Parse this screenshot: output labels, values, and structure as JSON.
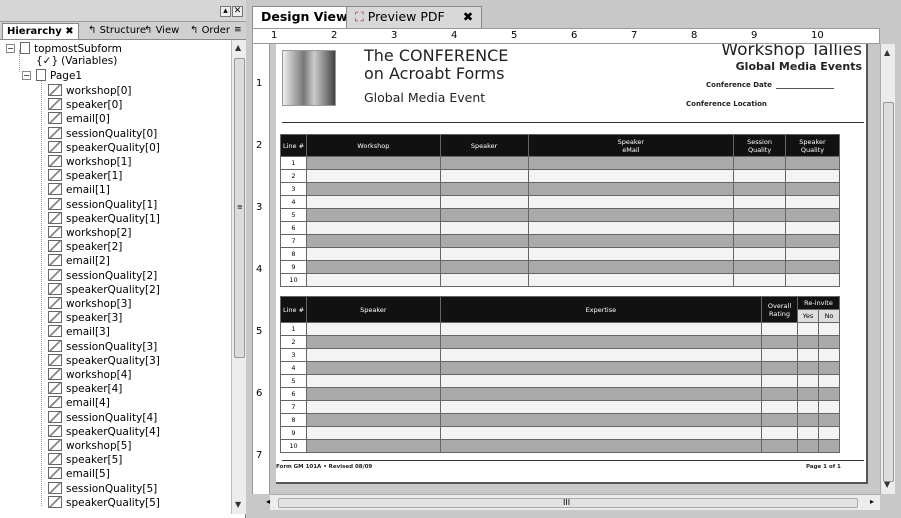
{
  "left_panel": {
    "tabs": [
      "Hierarchy",
      "Structure",
      "View",
      "Order"
    ],
    "tree": {
      "root": "topmostSubform",
      "variables": "(Variables)",
      "page": "Page1",
      "fields": [
        "workshop[0]",
        "speaker[0]",
        "email[0]",
        "sessionQuality[0]",
        "speakerQuality[0]",
        "workshop[1]",
        "speaker[1]",
        "email[1]",
        "sessionQuality[1]",
        "speakerQuality[1]",
        "workshop[2]",
        "speaker[2]",
        "email[2]",
        "sessionQuality[2]",
        "speakerQuality[2]",
        "workshop[3]",
        "speaker[3]",
        "email[3]",
        "sessionQuality[3]",
        "speakerQuality[3]",
        "workshop[4]",
        "speaker[4]",
        "email[4]",
        "sessionQuality[4]",
        "speakerQuality[4]",
        "workshop[5]",
        "speaker[5]",
        "email[5]",
        "sessionQuality[5]",
        "speakerQuality[5]"
      ]
    }
  },
  "doc_tabs": {
    "design": "Design View",
    "preview": "Preview PDF"
  },
  "ruler": {
    "top": [
      "1",
      "2",
      "3",
      "4",
      "5",
      "6",
      "7",
      "8",
      "9",
      "10"
    ],
    "left": [
      "1",
      "2",
      "3",
      "4",
      "5",
      "6",
      "7"
    ]
  },
  "form": {
    "title_line1": "The CONFERENCE",
    "title_line2": "on Acroabt Forms",
    "subtitle": "Global Media Event",
    "right_title": "Workshop Tallies",
    "right_subtitle": "Global Media Events",
    "conference_date": "Conference Date",
    "conference_location": "Conference Location",
    "table1_headers": [
      "Line #",
      "Workshop",
      "Speaker",
      "Speaker\neMail",
      "Session\nQuality",
      "Speaker\nQuality"
    ],
    "table2_headers": [
      "Line #",
      "Speaker",
      "Expertise",
      "Overall\nRating",
      "Re-invite",
      "Yes",
      "No"
    ],
    "line_numbers": [
      "1",
      "2",
      "3",
      "4",
      "5",
      "6",
      "7",
      "8",
      "9",
      "10"
    ],
    "footer_left": "Form GM 101A • Revised 08/09",
    "footer_right": "Page 1 of 1"
  },
  "scrollbar_label": "III"
}
